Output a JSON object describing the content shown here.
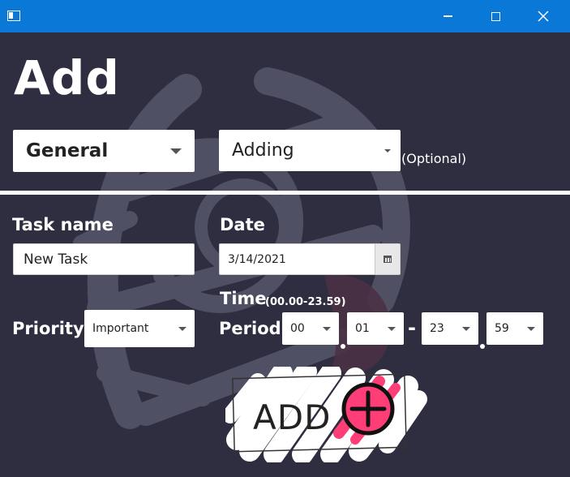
{
  "window": {
    "title": "",
    "icon": "app-window-icon",
    "controls": [
      "minimize-icon",
      "maximize-icon",
      "close-icon"
    ]
  },
  "header": {
    "title": "Add",
    "category_select": {
      "value": "General"
    },
    "mode_select": {
      "value": "Adding"
    },
    "optional_label": "(Optional)"
  },
  "form": {
    "task_name_label": "Task name",
    "task_name_value": "New Task",
    "date_label": "Date",
    "date_value": "3/14/2021",
    "time_label": "Time",
    "time_hint": "(00.00-23.59)",
    "priority_label": "Priority",
    "priority_value": "Important",
    "period_label": "Period",
    "period": {
      "start_hour": "00",
      "start_minute": "01",
      "separator": "-",
      "end_hour": "23",
      "end_minute": "59"
    }
  },
  "add_button": {
    "label": "ADD",
    "icon": "plus-circle-icon"
  },
  "colors": {
    "titlebar": "#0a78d6",
    "background": "#2e2e40",
    "accent": "#ff3d77"
  }
}
